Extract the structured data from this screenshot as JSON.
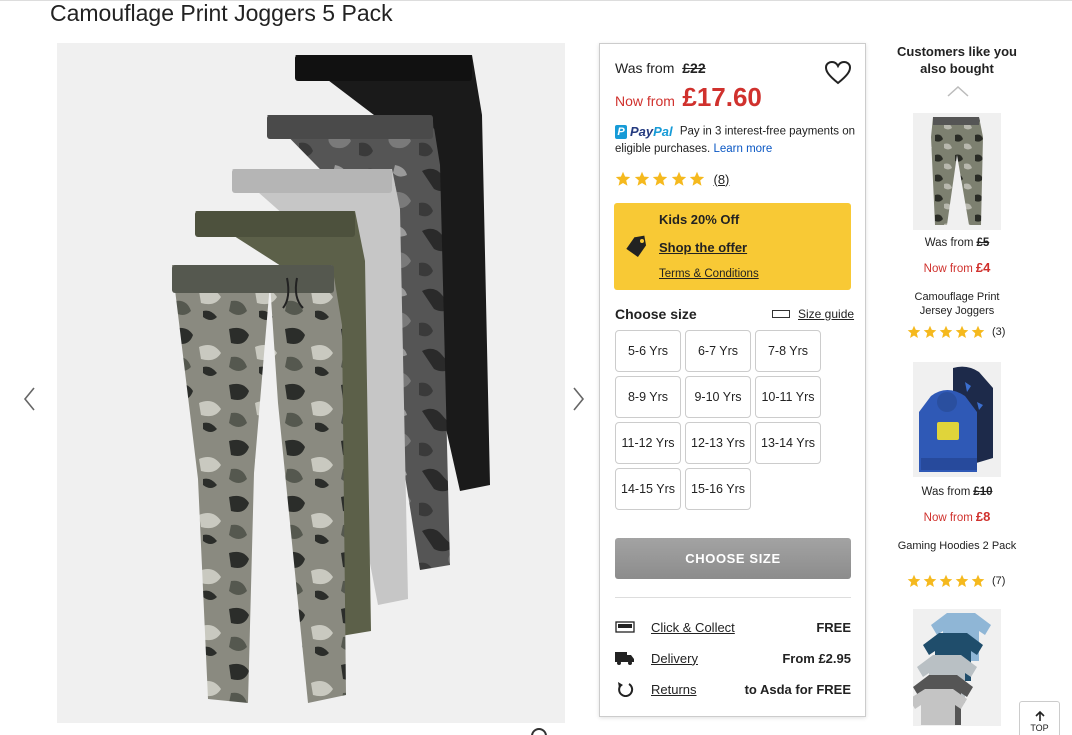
{
  "product": {
    "title": "Camouflage Print Joggers 5 Pack",
    "was_label": "Was from",
    "was_price": "£22",
    "now_label": "Now from",
    "now_price": "£17.60",
    "paypal_text": "Pay in 3 interest-free payments on eligible purchases.",
    "paypal_learn_more": "Learn more",
    "rating": 5,
    "review_count": "(8)",
    "colors": {
      "sale_red": "#d0312d",
      "offer_yellow": "#f8c935",
      "star_yellow": "#f5b91e",
      "paypal_blue": "#253b80"
    }
  },
  "offer": {
    "title": "Kids 20% Off",
    "shop_link": "Shop the offer",
    "terms_link": "Terms & Conditions",
    "icon": "price-tag-icon"
  },
  "size_selector": {
    "label": "Choose size",
    "guide_label": "Size guide",
    "sizes": [
      "5-6 Yrs",
      "6-7 Yrs",
      "7-8 Yrs",
      "8-9 Yrs",
      "9-10 Yrs",
      "10-11 Yrs",
      "11-12 Yrs",
      "12-13 Yrs",
      "13-14 Yrs",
      "14-15 Yrs",
      "15-16 Yrs"
    ]
  },
  "cta": {
    "label": "CHOOSE SIZE"
  },
  "services": [
    {
      "icon": "click-collect-icon",
      "label": "Click & Collect",
      "value": "FREE"
    },
    {
      "icon": "delivery-truck-icon",
      "label": "Delivery",
      "value": "From £2.95"
    },
    {
      "icon": "returns-icon",
      "label": "Returns",
      "value": "to Asda for FREE"
    }
  ],
  "recommendations": {
    "title": "Customers like you also bought",
    "items": [
      {
        "was_label": "Was from",
        "was_price": "£5",
        "now_label": "Now from",
        "now_price": "£4",
        "name": "Camouflage Print Jersey Joggers",
        "rating": 5,
        "review_count": "(3)"
      },
      {
        "was_label": "Was from",
        "was_price": "£10",
        "now_label": "Now from",
        "now_price": "£8",
        "name": "Gaming Hoodies 2 Pack",
        "rating": 5,
        "review_count": "(7)"
      }
    ]
  },
  "top_button": {
    "label": "TOP"
  }
}
